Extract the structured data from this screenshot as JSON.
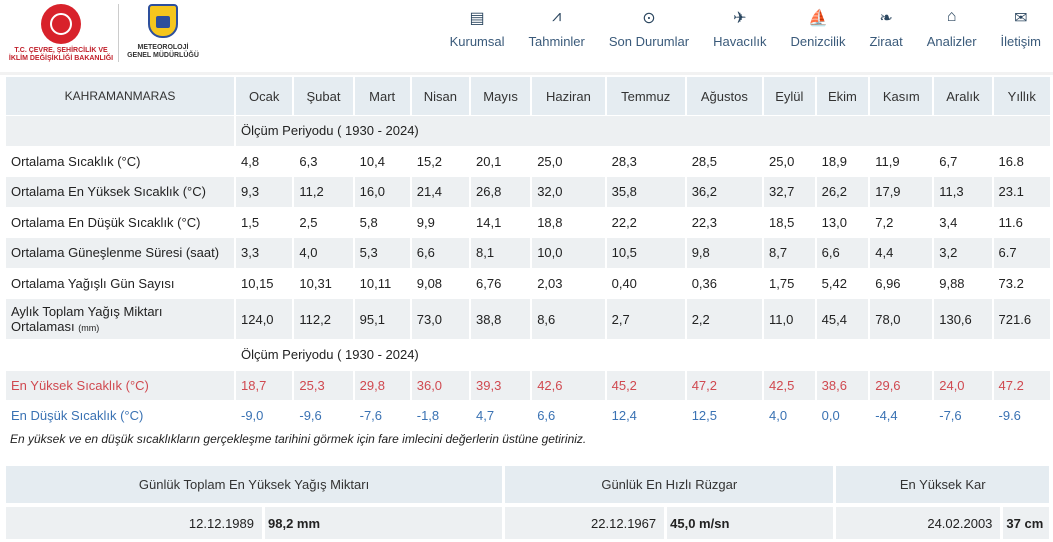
{
  "header": {
    "ministry_text": "T.C. ÇEVRE, ŞEHİRCİLİK VE İKLİM DEĞİŞİKLİĞİ BAKANLIĞI",
    "met_shield_text": "METEOROLOJİ",
    "met_text": "METEOROLOJİ GENEL MÜDÜRLÜĞÜ",
    "nav": [
      {
        "label": "Kurumsal",
        "icon": "document-icon",
        "glyph": "▤"
      },
      {
        "label": "Tahminler",
        "icon": "chart-icon",
        "glyph": "⩘"
      },
      {
        "label": "Son Durumlar",
        "icon": "check-circle-icon",
        "glyph": "⊙"
      },
      {
        "label": "Havacılık",
        "icon": "plane-icon",
        "glyph": "✈"
      },
      {
        "label": "Denizcilik",
        "icon": "sailboat-icon",
        "glyph": "⛵"
      },
      {
        "label": "Ziraat",
        "icon": "leaf-icon",
        "glyph": "❧"
      },
      {
        "label": "Analizler",
        "icon": "analysis-icon",
        "glyph": "⌂"
      },
      {
        "label": "İletişim",
        "icon": "mail-icon",
        "glyph": "✉"
      }
    ]
  },
  "table": {
    "city": "KAHRAMANMARAS",
    "months": [
      "Ocak",
      "Şubat",
      "Mart",
      "Nisan",
      "Mayıs",
      "Haziran",
      "Temmuz",
      "Ağustos",
      "Eylül",
      "Ekim",
      "Kasım",
      "Aralık",
      "Yıllık"
    ],
    "period1": "Ölçüm Periyodu ( 1930 - 2024)",
    "rows": [
      {
        "label": "Ortalama Sıcaklık (°C)",
        "values": [
          "4,8",
          "6,3",
          "10,4",
          "15,2",
          "20,1",
          "25,0",
          "28,3",
          "28,5",
          "25,0",
          "18,9",
          "11,9",
          "6,7",
          "16.8"
        ]
      },
      {
        "label": "Ortalama En Yüksek Sıcaklık (°C)",
        "values": [
          "9,3",
          "11,2",
          "16,0",
          "21,4",
          "26,8",
          "32,0",
          "35,8",
          "36,2",
          "32,7",
          "26,2",
          "17,9",
          "11,3",
          "23.1"
        ]
      },
      {
        "label": "Ortalama En Düşük Sıcaklık (°C)",
        "values": [
          "1,5",
          "2,5",
          "5,8",
          "9,9",
          "14,1",
          "18,8",
          "22,2",
          "22,3",
          "18,5",
          "13,0",
          "7,2",
          "3,4",
          "11.6"
        ]
      },
      {
        "label": "Ortalama Güneşlenme Süresi (saat)",
        "values": [
          "3,3",
          "4,0",
          "5,3",
          "6,6",
          "8,1",
          "10,0",
          "10,5",
          "9,8",
          "8,7",
          "6,6",
          "4,4",
          "3,2",
          "6.7"
        ]
      },
      {
        "label": "Ortalama Yağışlı Gün Sayısı",
        "values": [
          "10,15",
          "10,31",
          "10,11",
          "9,08",
          "6,76",
          "2,03",
          "0,40",
          "0,36",
          "1,75",
          "5,42",
          "6,96",
          "9,88",
          "73.2"
        ]
      }
    ],
    "precip_row": {
      "label_main": "Aylık Toplam Yağış Miktarı Ortalaması",
      "label_unit": "(mm)",
      "values": [
        "124,0",
        "112,2",
        "95,1",
        "73,0",
        "38,8",
        "8,6",
        "2,7",
        "2,2",
        "11,0",
        "45,4",
        "78,0",
        "130,6",
        "721.6"
      ]
    },
    "period2": "Ölçüm Periyodu ( 1930 - 2024)",
    "max_row": {
      "label": "En Yüksek Sıcaklık (°C)",
      "values": [
        "18,7",
        "25,3",
        "29,8",
        "36,0",
        "39,3",
        "42,6",
        "45,2",
        "47,2",
        "42,5",
        "38,6",
        "29,6",
        "24,0",
        "47.2"
      ]
    },
    "min_row": {
      "label": "En Düşük Sıcaklık (°C)",
      "values": [
        "-9,0",
        "-9,6",
        "-7,6",
        "-1,8",
        "4,7",
        "6,6",
        "12,4",
        "12,5",
        "4,0",
        "0,0",
        "-4,4",
        "-7,6",
        "-9.6"
      ]
    },
    "note": "En yüksek ve en düşük sıcaklıkların gerçekleşme tarihini görmek için fare imlecini değerlerin üstüne getiriniz."
  },
  "extremes": [
    {
      "title": "Günlük Toplam En Yüksek Yağış Miktarı",
      "date": "12.12.1989",
      "value": "98,2 mm"
    },
    {
      "title": "Günlük En Hızlı Rüzgar",
      "date": "22.12.1967",
      "value": "45,0 m/sn"
    },
    {
      "title": "En Yüksek Kar",
      "date": "24.02.2003",
      "value": "37 cm"
    }
  ],
  "colors": {
    "hot": "#d04950",
    "cold": "#3a72b3",
    "header_bg": "#e5ecf1",
    "row_bg": "#edf0f2"
  }
}
